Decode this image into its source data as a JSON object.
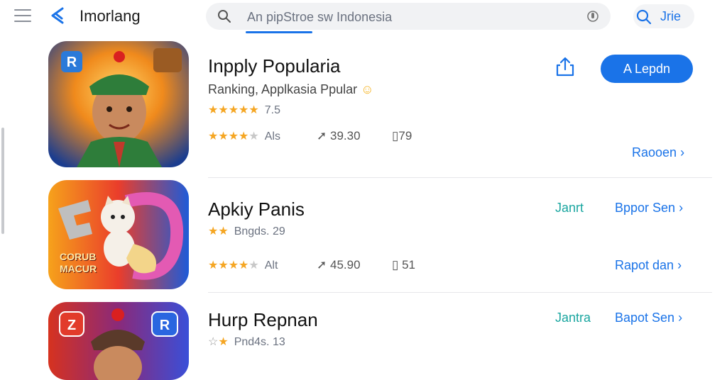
{
  "header": {
    "title": "Imorlang",
    "search_placeholder": "An pipStroe sw Indonesia",
    "action_label": "Jrie"
  },
  "apps": [
    {
      "name": "Inpply Popularia",
      "subtitle": "Ranking, Applkasia Ppular",
      "rating_text": "7.5",
      "meta_rating": "Als",
      "downloads": "39.30",
      "size": "79",
      "get_label": "A Lepdn",
      "link_label": "Raooen"
    },
    {
      "name": "Apkiy Panis",
      "rating_text": "Bngds. 29",
      "meta_rating": "Alt",
      "downloads": "45.90",
      "size": "51",
      "status_label": "Janrt",
      "link_label": "Bppor Sen",
      "link2_label": "Rapot dan",
      "icon_text": "CORUB MACUR"
    },
    {
      "name": "Hurp Repnan",
      "rating_text": "Pnd4s. 13",
      "status_label": "Jantra",
      "link_label": "Bapot Sen"
    }
  ],
  "colors": {
    "accent": "#1a73e8",
    "teal": "#1aa6a0",
    "star": "#f5a623"
  }
}
